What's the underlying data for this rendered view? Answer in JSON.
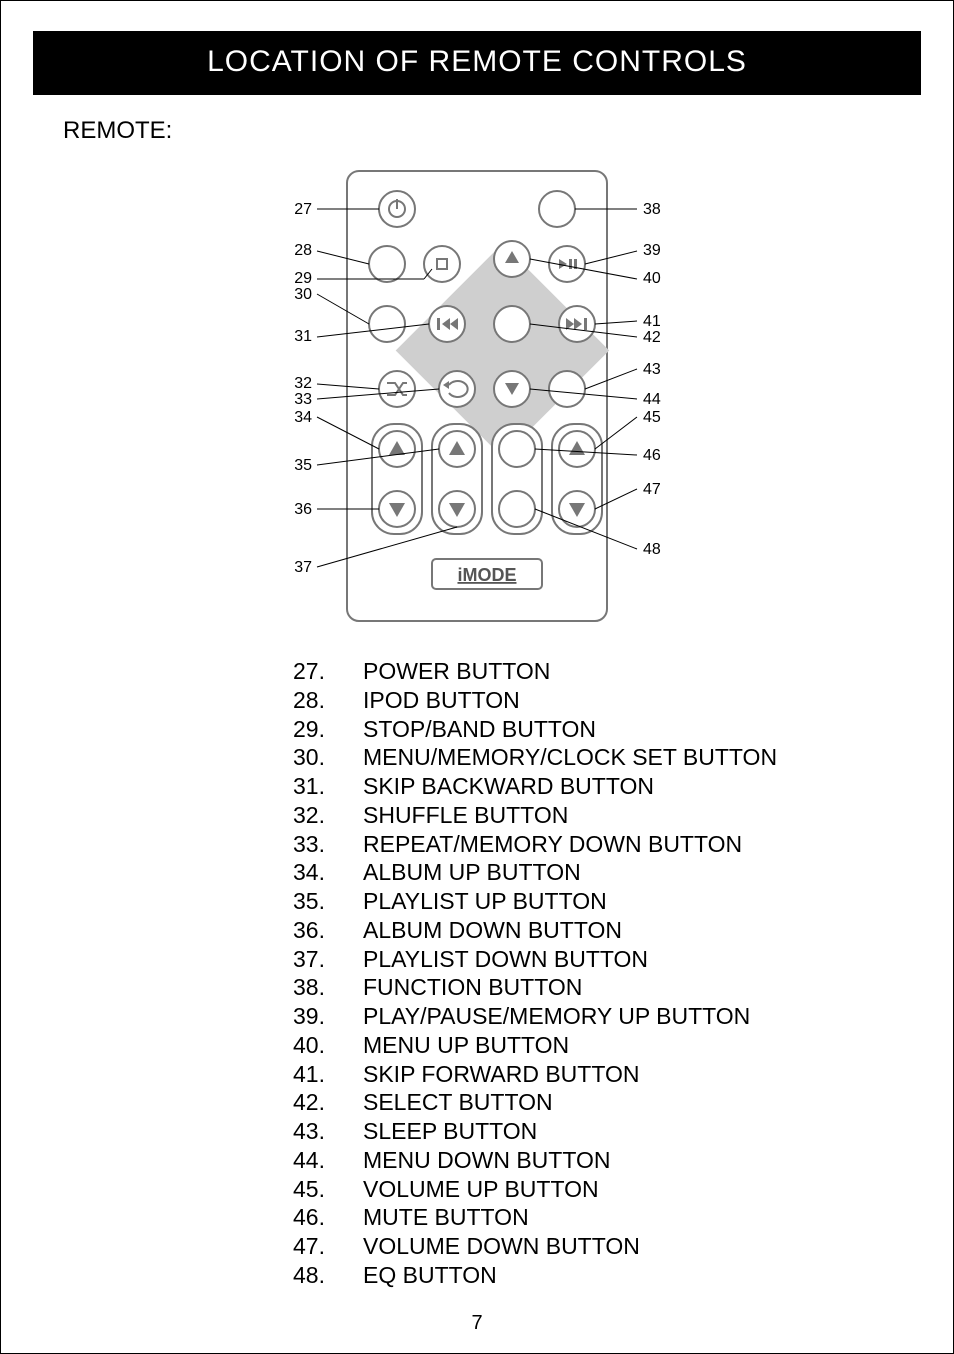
{
  "header": {
    "title": "LOCATION OF REMOTE CONTROLS"
  },
  "subheading": "REMOTE:",
  "brand": "iMODE",
  "page_number": "7",
  "controls": [
    {
      "num": "27.",
      "label": "POWER BUTTON"
    },
    {
      "num": "28.",
      "label": "IPOD BUTTON"
    },
    {
      "num": "29.",
      "label": "STOP/BAND BUTTON"
    },
    {
      "num": "30.",
      "label": "MENU/MEMORY/CLOCK SET BUTTON"
    },
    {
      "num": "31.",
      "label": "SKIP BACKWARD BUTTON"
    },
    {
      "num": "32.",
      "label": "SHUFFLE BUTTON"
    },
    {
      "num": "33.",
      "label": "REPEAT/MEMORY DOWN BUTTON"
    },
    {
      "num": "34.",
      "label": "ALBUM UP BUTTON"
    },
    {
      "num": "35.",
      "label": "PLAYLIST UP BUTTON"
    },
    {
      "num": "36.",
      "label": "ALBUM DOWN BUTTON"
    },
    {
      "num": "37.",
      "label": "PLAYLIST DOWN BUTTON"
    },
    {
      "num": "38.",
      "label": "FUNCTION BUTTON"
    },
    {
      "num": "39.",
      "label": "PLAY/PAUSE/MEMORY UP BUTTON"
    },
    {
      "num": "40.",
      "label": "MENU UP BUTTON"
    },
    {
      "num": "41.",
      "label": "SKIP FORWARD BUTTON"
    },
    {
      "num": "42.",
      "label": "SELECT BUTTON"
    },
    {
      "num": "43.",
      "label": "SLEEP BUTTON"
    },
    {
      "num": "44.",
      "label": "MENU DOWN BUTTON"
    },
    {
      "num": "45.",
      "label": "VOLUME UP BUTTON"
    },
    {
      "num": "46.",
      "label": "MUTE BUTTON"
    },
    {
      "num": "47.",
      "label": "VOLUME DOWN BUTTON"
    },
    {
      "num": "48.",
      "label": "EQ BUTTON"
    }
  ],
  "callouts_left": [
    "27",
    "28",
    "29",
    "30",
    "31",
    "32",
    "33",
    "34",
    "35",
    "36",
    "37"
  ],
  "callouts_right": [
    "38",
    "39",
    "40",
    "41",
    "42",
    "43",
    "44",
    "45",
    "46",
    "47",
    "48"
  ]
}
